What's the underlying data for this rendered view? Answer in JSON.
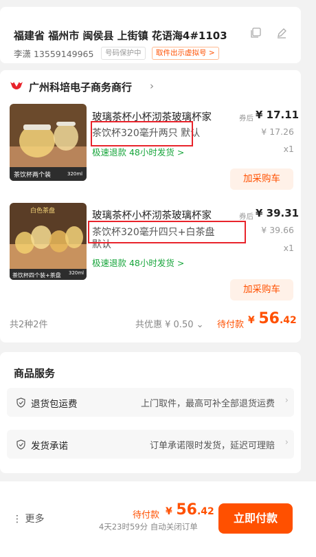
{
  "address": {
    "full": "福建省 福州市 闽侯县 上街镇 花语海4#1103",
    "contact": "李潇 13559149965",
    "privacy_tag": "号码保护中",
    "virtual_number_tag": "取件出示虚拟号 >"
  },
  "shop": {
    "name": "广州科培电子商务商行",
    "arrow": "›"
  },
  "products": [
    {
      "title": "玻璃茶杯小杯沏茶玻璃杯家",
      "price_label": "券后",
      "price": "¥ 17.11",
      "original_price": "¥ 17.26",
      "quantity": "x1",
      "sku": "茶饮杯320毫升两只",
      "sku_suffix": " 默认",
      "service_tags": "极速退款  48小时发货 >",
      "cart_button": "加采购车",
      "thumb_caption": "茶饮杯两个装",
      "thumb_badge": "320ml"
    },
    {
      "title": "玻璃茶杯小杯沏茶玻璃杯家",
      "price_label": "券后",
      "price": "¥ 39.31",
      "original_price": "¥ 39.66",
      "quantity": "x1",
      "sku": "茶饮杯320毫升四只+白茶盘",
      "sku_suffix": "默认",
      "service_tags": "极速退款  48小时发货 >",
      "cart_button": "加采购车",
      "thumb_caption": "茶饮杯四个装+茶盘",
      "thumb_badge": "320ml",
      "thumb_top_label": "白色茶盘"
    }
  ],
  "summary": {
    "count": "共2种2件",
    "discount": "共优惠 ¥ 0.50 ⌄",
    "pay_label": "待付款",
    "pay_symbol": "¥",
    "pay_int": "56",
    "pay_dec": ".42"
  },
  "services": {
    "title": "商品服务",
    "rows": [
      {
        "name": "退货包运费",
        "desc": "上门取件，最高可补全部退货运费",
        "chevron": "›"
      },
      {
        "name": "发货承诺",
        "desc": "订单承诺限时发货，延迟可理赔",
        "chevron": "›"
      }
    ]
  },
  "bottom": {
    "more": "⋮ 更多",
    "pay_label": "待付款",
    "pay_symbol": "¥",
    "pay_int": "56",
    "pay_dec": ".42",
    "countdown": "4天23时59分 自动关闭订单",
    "pay_button": "立即付款"
  },
  "colors": {
    "accent": "#ff5000",
    "green": "#17a53b",
    "highlight_box": "#e8232b"
  }
}
